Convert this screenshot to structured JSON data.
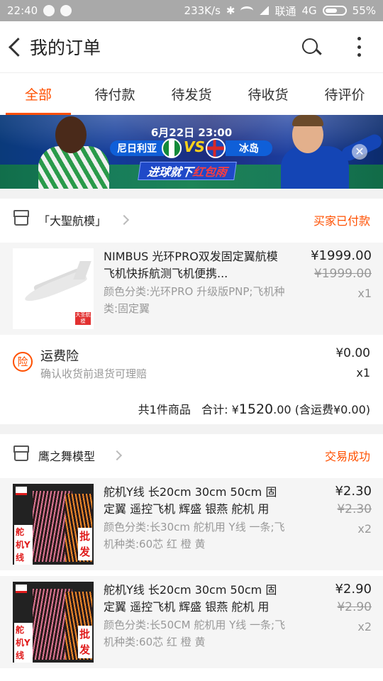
{
  "status_bar": {
    "time": "22:40",
    "speed": "233K/s",
    "carrier": "联通",
    "network": "4G",
    "battery": "55%"
  },
  "header": {
    "title": "我的订单"
  },
  "tabs": [
    {
      "label": "全部",
      "active": true
    },
    {
      "label": "待付款",
      "active": false
    },
    {
      "label": "待发货",
      "active": false
    },
    {
      "label": "待收货",
      "active": false
    },
    {
      "label": "待评价",
      "active": false
    }
  ],
  "banner": {
    "date": "6月22日 23:00",
    "team_left": "尼日利亚",
    "vs": "VS",
    "team_right": "冰岛",
    "slogan_a": "进球就下",
    "slogan_b": "红包雨",
    "close": "✕"
  },
  "orders": [
    {
      "shop": "「大聖航模」",
      "status": "买家已付款",
      "items": [
        {
          "title": "NIMBUS 光环PRO双发固定翼航模飞机快拆航测飞机便携...",
          "sku": "颜色分类:光环PRO 升级版PNP;飞机种类:固定翼",
          "price": "¥1999.00",
          "original_price": "¥1999.00",
          "qty": "x1",
          "thumb_logo": "大圣航模"
        }
      ],
      "insurance": {
        "icon": "险",
        "title": "运费险",
        "desc": "确认收货前退货可理赔",
        "price": "¥0.00",
        "qty": "x1"
      },
      "summary": {
        "count": "共1件商品",
        "total_label": "合计:",
        "total_prefix": "¥",
        "total_int": "1520",
        "total_dec": ".00",
        "shipping": "(含运费¥0.00)"
      }
    },
    {
      "shop": "鹰之舞模型",
      "status": "交易成功",
      "items": [
        {
          "title": "舵机Y线 长20cm 30cm 50cm 固定翼 遥控飞机 辉盛 银燕 舵机 用",
          "sku": "颜色分类:长30cm 舵机用 Y线 一条;飞机种类:60芯 红 橙 黄",
          "price": "¥2.30",
          "original_price": "¥2.30",
          "qty": "x2",
          "thumb_label": "舵机Y线一分二",
          "thumb_tag": "批发"
        },
        {
          "title": "舵机Y线 长20cm 30cm 50cm 固定翼 遥控飞机 辉盛 银燕 舵机 用",
          "sku": "颜色分类:长50CM 舵机用 Y线 一条;飞机种类:60芯 红 橙 黄",
          "price": "¥2.90",
          "original_price": "¥2.90",
          "qty": "x2",
          "thumb_label": "舵机Y线一分二",
          "thumb_tag": "批发"
        }
      ]
    }
  ],
  "colors": {
    "accent": "#ff5000",
    "status_bar": "#a9a9a9"
  }
}
